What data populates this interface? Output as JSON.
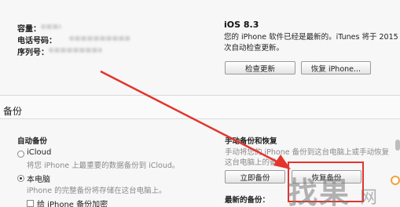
{
  "device_info": {
    "capacity_label": "容量：",
    "phone_label": "电话号码：",
    "serial_label": "序列号："
  },
  "ios": {
    "version": "iOS 8.3",
    "message_line1": "您的 iPhone 软件已经是最新的。iTunes 将于 2015",
    "message_line2": "次自动检查更新。",
    "check_update_label": "检查更新",
    "restore_iphone_label": "恢复 iPhone..."
  },
  "backup": {
    "section_title": "备份",
    "auto_backup_title": "自动备份",
    "icloud_label": "iCloud",
    "icloud_desc": "将您 iPhone 上最重要的数据备份到 iCloud。",
    "this_computer_label": "本电脑",
    "this_computer_desc": "iPhone 的完整备份将存储在这台电脑上。",
    "encrypt_label": "给 iPhone 备份加密",
    "selected_option": "本电脑",
    "manual_title": "手动备份和恢复",
    "manual_desc_line1": "手动将您的 iPhone 备份到这台电脑上或手动恢复",
    "manual_desc_line2": "这台电脑上的备份。",
    "backup_now_label": "立即备份",
    "restore_backup_label": "恢复备份",
    "latest_backup_label": "最新的备份："
  },
  "watermark": {
    "text": "找果",
    "small_text": "网"
  },
  "annotation_color": "#e4342c"
}
